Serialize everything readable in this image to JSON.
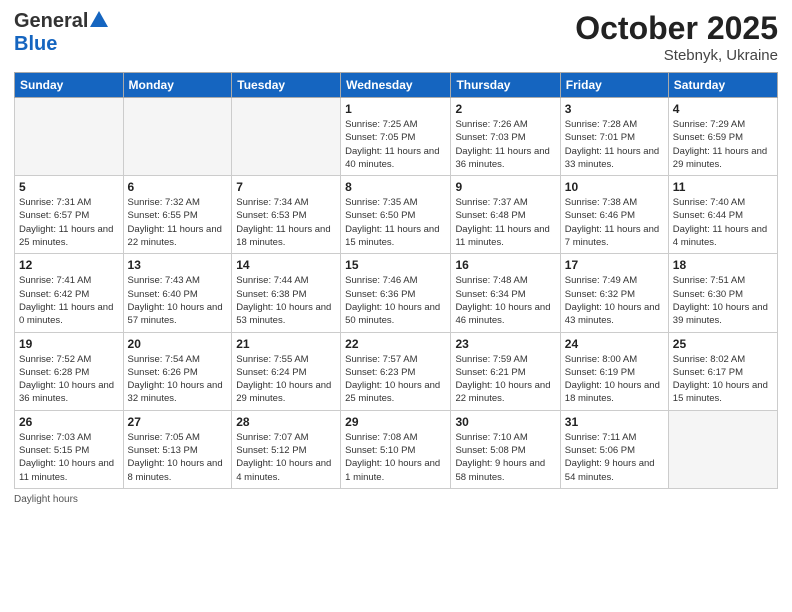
{
  "header": {
    "logo_general": "General",
    "logo_blue": "Blue",
    "month_title": "October 2025",
    "location": "Stebnyk, Ukraine"
  },
  "footer": {
    "daylight_hours": "Daylight hours"
  },
  "weekdays": [
    "Sunday",
    "Monday",
    "Tuesday",
    "Wednesday",
    "Thursday",
    "Friday",
    "Saturday"
  ],
  "weeks": [
    [
      {
        "day": "",
        "info": ""
      },
      {
        "day": "",
        "info": ""
      },
      {
        "day": "",
        "info": ""
      },
      {
        "day": "1",
        "info": "Sunrise: 7:25 AM\nSunset: 7:05 PM\nDaylight: 11 hours\nand 40 minutes."
      },
      {
        "day": "2",
        "info": "Sunrise: 7:26 AM\nSunset: 7:03 PM\nDaylight: 11 hours\nand 36 minutes."
      },
      {
        "day": "3",
        "info": "Sunrise: 7:28 AM\nSunset: 7:01 PM\nDaylight: 11 hours\nand 33 minutes."
      },
      {
        "day": "4",
        "info": "Sunrise: 7:29 AM\nSunset: 6:59 PM\nDaylight: 11 hours\nand 29 minutes."
      }
    ],
    [
      {
        "day": "5",
        "info": "Sunrise: 7:31 AM\nSunset: 6:57 PM\nDaylight: 11 hours\nand 25 minutes."
      },
      {
        "day": "6",
        "info": "Sunrise: 7:32 AM\nSunset: 6:55 PM\nDaylight: 11 hours\nand 22 minutes."
      },
      {
        "day": "7",
        "info": "Sunrise: 7:34 AM\nSunset: 6:53 PM\nDaylight: 11 hours\nand 18 minutes."
      },
      {
        "day": "8",
        "info": "Sunrise: 7:35 AM\nSunset: 6:50 PM\nDaylight: 11 hours\nand 15 minutes."
      },
      {
        "day": "9",
        "info": "Sunrise: 7:37 AM\nSunset: 6:48 PM\nDaylight: 11 hours\nand 11 minutes."
      },
      {
        "day": "10",
        "info": "Sunrise: 7:38 AM\nSunset: 6:46 PM\nDaylight: 11 hours\nand 7 minutes."
      },
      {
        "day": "11",
        "info": "Sunrise: 7:40 AM\nSunset: 6:44 PM\nDaylight: 11 hours\nand 4 minutes."
      }
    ],
    [
      {
        "day": "12",
        "info": "Sunrise: 7:41 AM\nSunset: 6:42 PM\nDaylight: 11 hours\nand 0 minutes."
      },
      {
        "day": "13",
        "info": "Sunrise: 7:43 AM\nSunset: 6:40 PM\nDaylight: 10 hours\nand 57 minutes."
      },
      {
        "day": "14",
        "info": "Sunrise: 7:44 AM\nSunset: 6:38 PM\nDaylight: 10 hours\nand 53 minutes."
      },
      {
        "day": "15",
        "info": "Sunrise: 7:46 AM\nSunset: 6:36 PM\nDaylight: 10 hours\nand 50 minutes."
      },
      {
        "day": "16",
        "info": "Sunrise: 7:48 AM\nSunset: 6:34 PM\nDaylight: 10 hours\nand 46 minutes."
      },
      {
        "day": "17",
        "info": "Sunrise: 7:49 AM\nSunset: 6:32 PM\nDaylight: 10 hours\nand 43 minutes."
      },
      {
        "day": "18",
        "info": "Sunrise: 7:51 AM\nSunset: 6:30 PM\nDaylight: 10 hours\nand 39 minutes."
      }
    ],
    [
      {
        "day": "19",
        "info": "Sunrise: 7:52 AM\nSunset: 6:28 PM\nDaylight: 10 hours\nand 36 minutes."
      },
      {
        "day": "20",
        "info": "Sunrise: 7:54 AM\nSunset: 6:26 PM\nDaylight: 10 hours\nand 32 minutes."
      },
      {
        "day": "21",
        "info": "Sunrise: 7:55 AM\nSunset: 6:24 PM\nDaylight: 10 hours\nand 29 minutes."
      },
      {
        "day": "22",
        "info": "Sunrise: 7:57 AM\nSunset: 6:23 PM\nDaylight: 10 hours\nand 25 minutes."
      },
      {
        "day": "23",
        "info": "Sunrise: 7:59 AM\nSunset: 6:21 PM\nDaylight: 10 hours\nand 22 minutes."
      },
      {
        "day": "24",
        "info": "Sunrise: 8:00 AM\nSunset: 6:19 PM\nDaylight: 10 hours\nand 18 minutes."
      },
      {
        "day": "25",
        "info": "Sunrise: 8:02 AM\nSunset: 6:17 PM\nDaylight: 10 hours\nand 15 minutes."
      }
    ],
    [
      {
        "day": "26",
        "info": "Sunrise: 7:03 AM\nSunset: 5:15 PM\nDaylight: 10 hours\nand 11 minutes."
      },
      {
        "day": "27",
        "info": "Sunrise: 7:05 AM\nSunset: 5:13 PM\nDaylight: 10 hours\nand 8 minutes."
      },
      {
        "day": "28",
        "info": "Sunrise: 7:07 AM\nSunset: 5:12 PM\nDaylight: 10 hours\nand 4 minutes."
      },
      {
        "day": "29",
        "info": "Sunrise: 7:08 AM\nSunset: 5:10 PM\nDaylight: 10 hours\nand 1 minute."
      },
      {
        "day": "30",
        "info": "Sunrise: 7:10 AM\nSunset: 5:08 PM\nDaylight: 9 hours\nand 58 minutes."
      },
      {
        "day": "31",
        "info": "Sunrise: 7:11 AM\nSunset: 5:06 PM\nDaylight: 9 hours\nand 54 minutes."
      },
      {
        "day": "",
        "info": ""
      }
    ]
  ]
}
